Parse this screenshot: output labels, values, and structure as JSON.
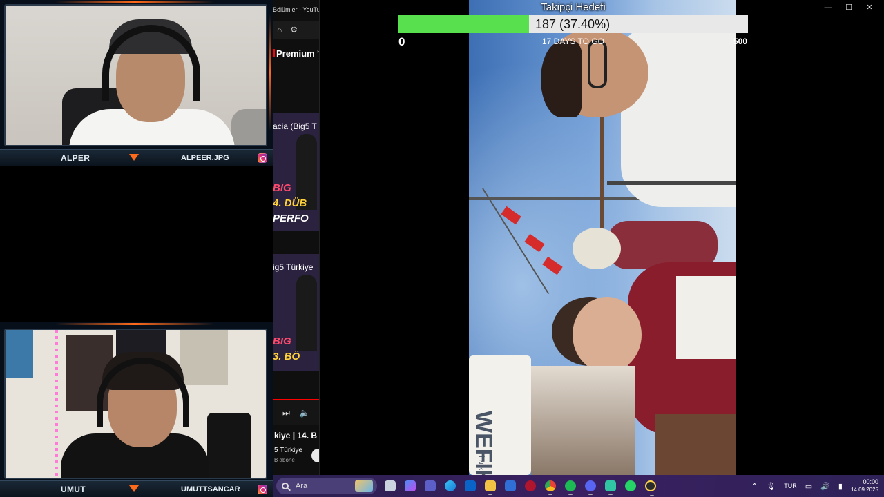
{
  "webcams": {
    "top": {
      "name": "ALPER",
      "handle": "ALPEER.JPG"
    },
    "bottom": {
      "name": "UMUT",
      "handle": "UMUTTSANCAR"
    }
  },
  "youtube": {
    "tab_title": "Bölümler - YouTube",
    "premium_label": "Premium",
    "premium_tm": "TR",
    "thumb1": {
      "title": "acia (Big5 T",
      "line1": "BIG",
      "line2": "4. DÜB",
      "line3": "PERFO"
    },
    "thumb2": {
      "title": "ig5 Türkiye",
      "line1": "BIG",
      "line2": "3. BÖ"
    },
    "now_playing_title": "kiye | 14. B",
    "channel": "5 Türkiye",
    "subscribers": "B abone"
  },
  "goal": {
    "title": "Takipçi Hedefi",
    "current": 187,
    "target": 500,
    "min_label": "0",
    "max_label": "500",
    "progress_text": "187 (37.40%)",
    "progress_fraction": 0.374,
    "days_text": "17 DAYS TO GO",
    "fill_color": "#58e04f"
  },
  "video": {
    "tent_text": "WEFIK",
    "tent_sub": "İ N K"
  },
  "window_controls": {
    "minimize": "—",
    "maximize": "☐",
    "close": "✕"
  },
  "taskbar": {
    "search_placeholder": "Ara",
    "language": "TUR",
    "time": "00:00",
    "date": "14.09.2025",
    "tray_chevron": "⌃",
    "mic_glyph": "🎙"
  }
}
